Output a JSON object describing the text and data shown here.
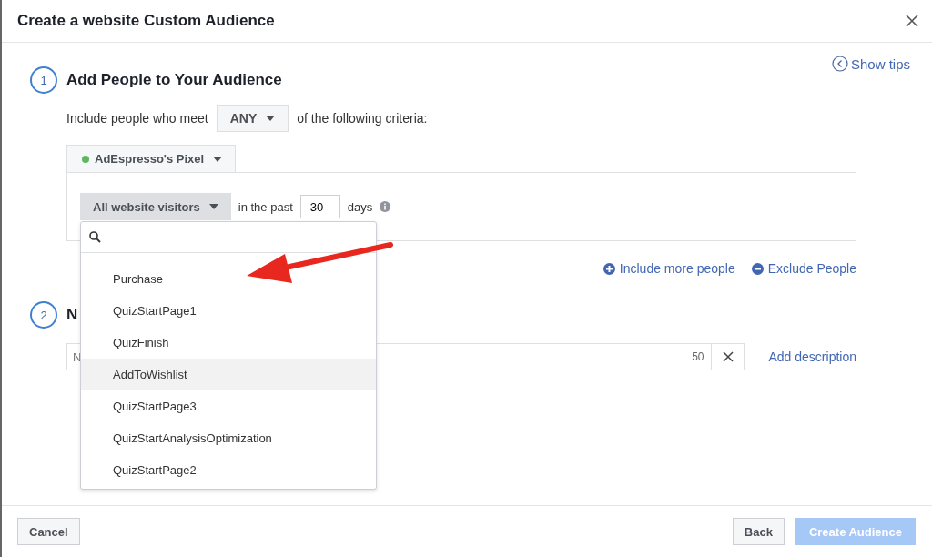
{
  "dialog": {
    "title": "Create a website Custom Audience",
    "show_tips": "Show tips"
  },
  "step1": {
    "number": "1",
    "title": "Add People to Your Audience",
    "include_prefix": "Include people who meet",
    "match": "ANY",
    "include_suffix": "of the following criteria:",
    "pixel": {
      "name": "AdEspresso's Pixel",
      "color": "#5cb85c"
    },
    "rule": {
      "event": "All website visitors",
      "in_the_past": "in the past",
      "days_value": "30",
      "days": "days"
    },
    "dropdown": {
      "items": [
        {
          "label": "Purchase",
          "highlighted": false
        },
        {
          "label": "QuizStartPage1",
          "highlighted": false
        },
        {
          "label": "QuizFinish",
          "highlighted": false
        },
        {
          "label": "AddToWishlist",
          "highlighted": true
        },
        {
          "label": "QuizStartPage3",
          "highlighted": false
        },
        {
          "label": "QuizStartAnalysisOptimization",
          "highlighted": false
        },
        {
          "label": "QuizStartPage2",
          "highlighted": false
        }
      ]
    },
    "links": [
      "Include more people",
      "Exclude People"
    ]
  },
  "step2": {
    "number": "2",
    "title": "N",
    "name_placeholder": "N",
    "counter": "50",
    "add_description": "Add description"
  },
  "footer": {
    "cancel": "Cancel",
    "back": "Back",
    "create": {
      "label": "Create Audience",
      "disabled": true
    }
  }
}
